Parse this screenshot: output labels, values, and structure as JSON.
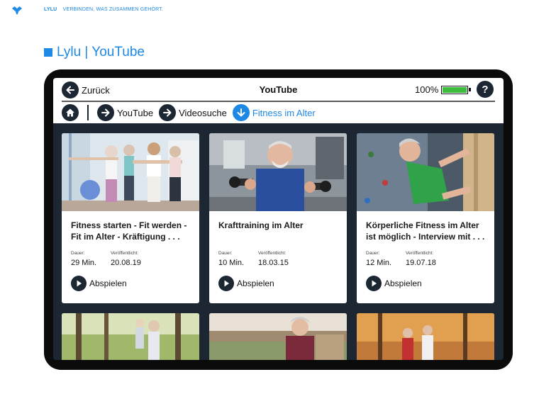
{
  "slide": {
    "brand": "LYLU",
    "tagline": "VERBINDEN, WAS ZUSAMMEN GEHÖRT.",
    "title": "Lylu | YouTube",
    "accent_color": "#1e88e5"
  },
  "app": {
    "back_label": "Zurück",
    "title": "YouTube",
    "battery_percent": "100%",
    "battery_level": 1.0,
    "help_label": "?",
    "breadcrumbs": [
      {
        "label": "YouTube",
        "icon": "arrow-right-icon"
      },
      {
        "label": "Videosuche",
        "icon": "arrow-right-icon"
      },
      {
        "label": "Fitness im Alter",
        "icon": "arrow-down-icon",
        "active": true
      }
    ],
    "duration_label": "Dauer:",
    "published_label": "Veröffentlicht:",
    "play_label": "Abspielen",
    "videos": [
      {
        "title": "Fitness starten - Fit werden - Fit im Alter - Kräftigung . . .",
        "duration": "29 Min.",
        "published": "20.08.19"
      },
      {
        "title": "Krafttraining im Alter",
        "duration": "10 Min.",
        "published": "18.03.15"
      },
      {
        "title": "Körperliche Fitness im Alter ist möglich - Interview mit . . .",
        "duration": "12 Min.",
        "published": "19.07.18"
      }
    ]
  }
}
